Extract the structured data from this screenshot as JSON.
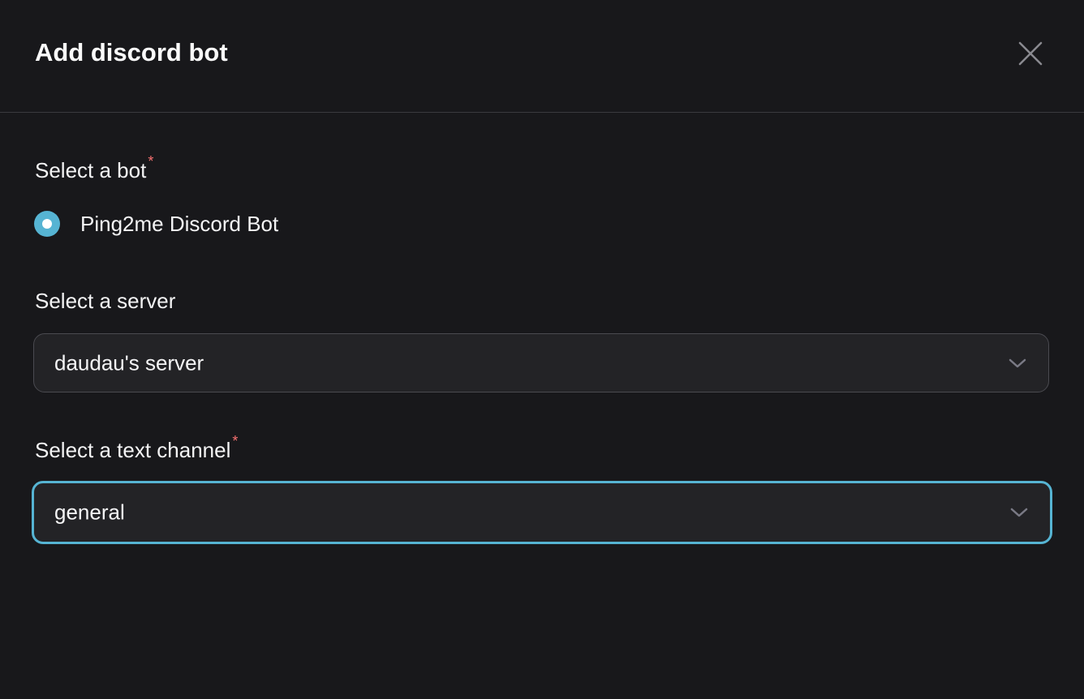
{
  "dialog": {
    "title": "Add discord bot",
    "close_icon": "close-icon"
  },
  "bot": {
    "label": "Select a bot",
    "required_mark": "*",
    "options": [
      {
        "label": "Ping2me Discord Bot",
        "selected": true
      }
    ]
  },
  "server": {
    "label": "Select a server",
    "value": "daudau's server"
  },
  "channel": {
    "label": "Select a text channel",
    "required_mark": "*",
    "value": "general"
  },
  "colors": {
    "accent": "#56b4d3",
    "required": "#f87171",
    "background": "#18181b"
  }
}
